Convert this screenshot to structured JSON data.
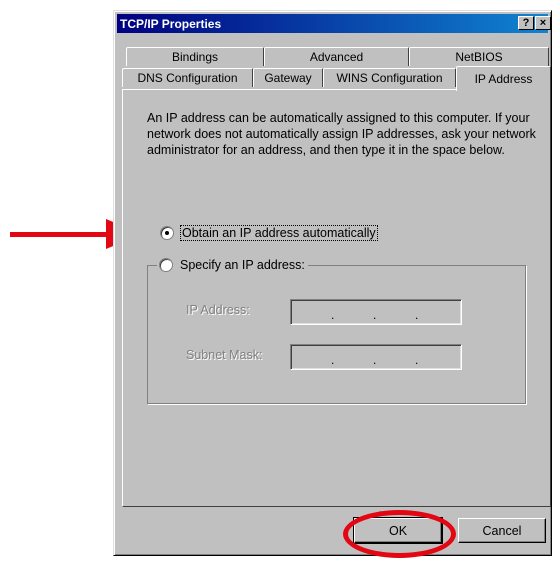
{
  "window": {
    "title": "TCP/IP Properties",
    "help_label": "?",
    "close_label": "×"
  },
  "tabs": {
    "row_back": [
      "Bindings",
      "Advanced",
      "NetBIOS"
    ],
    "row_front": [
      "DNS Configuration",
      "Gateway",
      "WINS Configuration",
      "IP Address"
    ],
    "active": "IP Address"
  },
  "description": "An IP address can be automatically assigned to this computer. If your network does not automatically assign IP addresses, ask your network administrator for an address, and then type it in the space below.",
  "options": {
    "obtain_auto": {
      "label": "Obtain an IP address automatically",
      "checked": true
    },
    "specify": {
      "label": "Specify an IP address:",
      "checked": false
    }
  },
  "fields": {
    "ip_address_label": "IP Address:",
    "subnet_mask_label": "Subnet Mask:",
    "ip_address_value": ". . .",
    "subnet_mask_value": ". . ."
  },
  "buttons": {
    "ok": "OK",
    "cancel": "Cancel"
  },
  "annotations": {
    "arrow_color": "#e30613",
    "circle_color": "#e30613"
  }
}
